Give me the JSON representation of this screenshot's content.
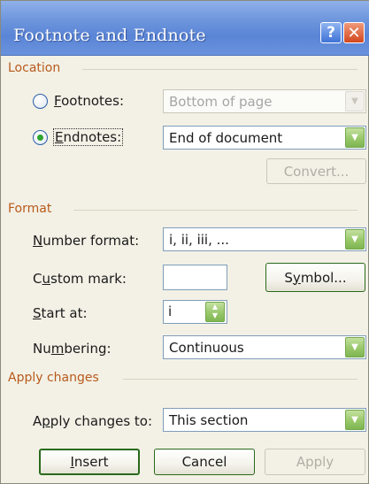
{
  "window": {
    "title": "Footnote and Endnote",
    "help_label": "?",
    "close_label": "✕"
  },
  "location": {
    "group_label": "Location",
    "footnotes_label": "Footnotes:",
    "footnotes_value": "Bottom of page",
    "footnotes_selected": false,
    "endnotes_label": "Endnotes:",
    "endnotes_value": "End of document",
    "endnotes_selected": true,
    "convert_label": "Convert..."
  },
  "format": {
    "group_label": "Format",
    "number_format_label": "Number format:",
    "number_format_value": "i, ii, iii, ...",
    "custom_mark_label": "Custom mark:",
    "custom_mark_value": "",
    "symbol_label": "Symbol...",
    "start_at_label": "Start at:",
    "start_at_value": "i",
    "numbering_label": "Numbering:",
    "numbering_value": "Continuous"
  },
  "apply_changes": {
    "group_label": "Apply changes",
    "apply_to_label": "Apply changes to:",
    "apply_to_value": "This section"
  },
  "buttons": {
    "insert_label": "Insert",
    "cancel_label": "Cancel",
    "apply_label": "Apply"
  },
  "colors": {
    "title_bar": "#6e96dd",
    "group_label": "#b85a1c",
    "dialog_bg": "#f3f1e6",
    "dropdown_arrow": "#98c86a"
  }
}
